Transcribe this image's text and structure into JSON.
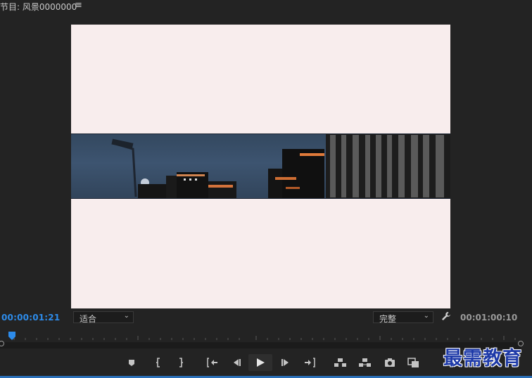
{
  "panel": {
    "title": "节目: 风景0000000",
    "menu_icon": "hamburger-menu-icon"
  },
  "viewer": {
    "background_color": "#f8eded",
    "content": "city-night-strip-image"
  },
  "toolbar": {
    "current_time": "00:00:01:21",
    "fit_select": {
      "selected": "适合",
      "icon": "chevron-down-icon"
    },
    "quality_select": {
      "selected": "完整",
      "icon": "chevron-down-icon"
    },
    "settings_icon": "wrench-icon",
    "duration": "00:01:00:10",
    "accent_color": "#2d8ceb"
  },
  "transport": {
    "buttons": [
      "add-marker-icon",
      "mark-in-icon",
      "mark-out-icon",
      "go-to-in-icon",
      "step-back-icon",
      "play-icon",
      "step-forward-icon",
      "go-to-out-icon",
      "lift-icon",
      "extract-icon",
      "export-frame-icon",
      "comparison-view-icon"
    ]
  },
  "watermark": {
    "text": "最需教育",
    "color": "#1e3aa8"
  }
}
